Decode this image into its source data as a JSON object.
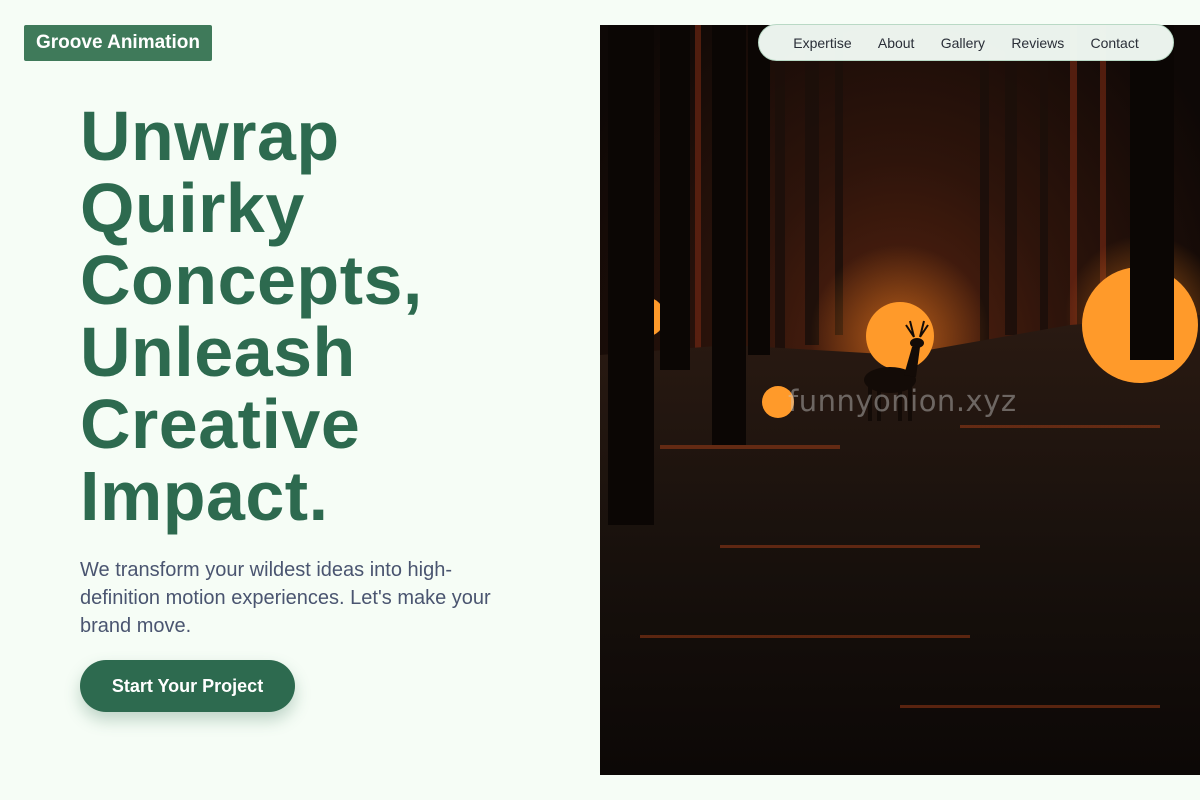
{
  "brand": {
    "name": "Groove Animation",
    "bg_color": "#3f7a5a"
  },
  "nav": {
    "items": [
      {
        "label": "Expertise"
      },
      {
        "label": "About"
      },
      {
        "label": "Gallery"
      },
      {
        "label": "Reviews"
      },
      {
        "label": "Contact"
      }
    ]
  },
  "hero": {
    "headline_lines": [
      "Unwrap",
      "Quirky",
      "Concepts,",
      "Unleash",
      "Creative",
      "Impact."
    ],
    "subtext": "We transform your wildest ideas into high-definition motion experiences. Let's make your brand move.",
    "cta_label": "Start Your Project",
    "accent_color": "#2d6a4f"
  },
  "image": {
    "alt": "Dark forest with glowing orange orbs and a silhouetted deer",
    "watermark": "funnyonion.xyz"
  }
}
